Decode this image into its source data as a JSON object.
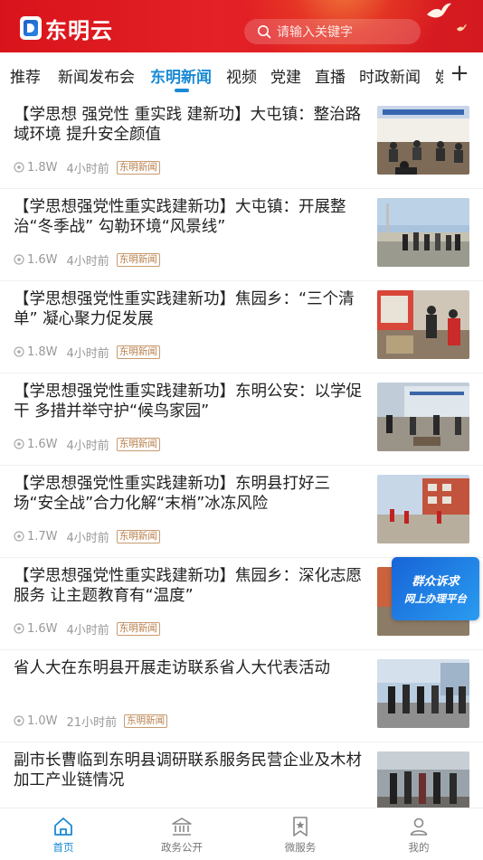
{
  "header": {
    "logo_text": "东明云",
    "search_placeholder": "请输入关键字"
  },
  "tabs": [
    {
      "label": "推荐"
    },
    {
      "label": "新闻发布会"
    },
    {
      "label": "东明新闻",
      "active": true
    },
    {
      "label": "视频"
    },
    {
      "label": "党建"
    },
    {
      "label": "直播"
    },
    {
      "label": "时政新闻"
    },
    {
      "label": "娱"
    }
  ],
  "tab_more_label": "+",
  "news": [
    {
      "title": "【学思想  强党性  重实践  建新功】大屯镇：整治路域环境    提升安全颜值",
      "views": "1.8W",
      "time": "4小时前",
      "tag": "东明新闻"
    },
    {
      "title": "【学思想强党性重实践建新功】大屯镇：开展整治“冬季战”  勾勒环境“风景线”",
      "views": "1.6W",
      "time": "4小时前",
      "tag": "东明新闻"
    },
    {
      "title": "【学思想强党性重实践建新功】焦园乡：“三个清单”    凝心聚力促发展",
      "views": "1.8W",
      "time": "4小时前",
      "tag": "东明新闻"
    },
    {
      "title": "【学思想强党性重实践建新功】东明公安：以学促干  多措并举守护“候鸟家园”",
      "views": "1.6W",
      "time": "4小时前",
      "tag": "东明新闻"
    },
    {
      "title": "【学思想强党性重实践建新功】东明县打好三场“安全战”合力化解“末梢”冰冻风险",
      "views": "1.7W",
      "time": "4小时前",
      "tag": "东明新闻"
    },
    {
      "title": "【学思想强党性重实践建新功】焦园乡：深化志愿服务  让主题教育有“温度”",
      "views": "1.6W",
      "time": "4小时前",
      "tag": "东明新闻"
    },
    {
      "title": "省人大在东明县开展走访联系省人大代表活动",
      "views": "1.0W",
      "time": "21小时前",
      "tag": "东明新闻"
    },
    {
      "title": "副市长曹临到东明县调研联系服务民营企业及木材加工产业链情况",
      "views": "",
      "time": "",
      "tag": ""
    }
  ],
  "float_ad": {
    "line1": "群众诉求",
    "line2": "网上办理平台"
  },
  "bottom_nav": [
    {
      "label": "首页",
      "active": true
    },
    {
      "label": "政务公开"
    },
    {
      "label": "微服务"
    },
    {
      "label": "我的"
    }
  ],
  "colors": {
    "brand_red": "#e32126",
    "accent_blue": "#1a8ad6",
    "tag_brown": "#b77e4a"
  }
}
